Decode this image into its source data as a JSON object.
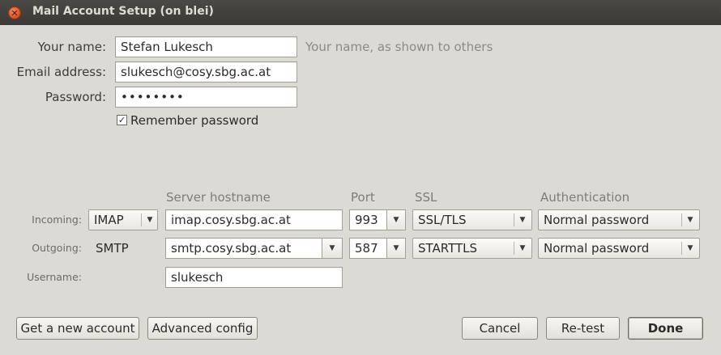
{
  "window": {
    "title": "Mail Account Setup (on blei)"
  },
  "identity": {
    "name_label": "Your name:",
    "name_value": "Stefan Lukesch",
    "name_hint": "Your name, as shown to others",
    "email_label": "Email address:",
    "email_value": "slukesch@cosy.sbg.ac.at",
    "password_label": "Password:",
    "password_value": "••••••••",
    "remember_label": "Remember password",
    "remember_checked": true
  },
  "server": {
    "headers": {
      "hostname": "Server hostname",
      "port": "Port",
      "ssl": "SSL",
      "auth": "Authentication"
    },
    "incoming": {
      "label": "Incoming:",
      "protocol": "IMAP",
      "hostname": "imap.cosy.sbg.ac.at",
      "port": "993",
      "ssl": "SSL/TLS",
      "auth": "Normal password"
    },
    "outgoing": {
      "label": "Outgoing:",
      "protocol": "SMTP",
      "hostname": "smtp.cosy.sbg.ac.at",
      "port": "587",
      "ssl": "STARTTLS",
      "auth": "Normal password"
    },
    "username": {
      "label": "Username:",
      "value": "slukesch"
    }
  },
  "buttons": {
    "new_account": "Get a new account",
    "advanced": "Advanced config",
    "cancel": "Cancel",
    "retest": "Re-test",
    "done": "Done"
  },
  "icons": {
    "close": "close-icon",
    "dropdown": "chevron-down-icon",
    "check": "checkmark-icon"
  },
  "colors": {
    "titlebar": "#3c3b37",
    "close": "#e05a2b",
    "background": "#dcdad5"
  }
}
